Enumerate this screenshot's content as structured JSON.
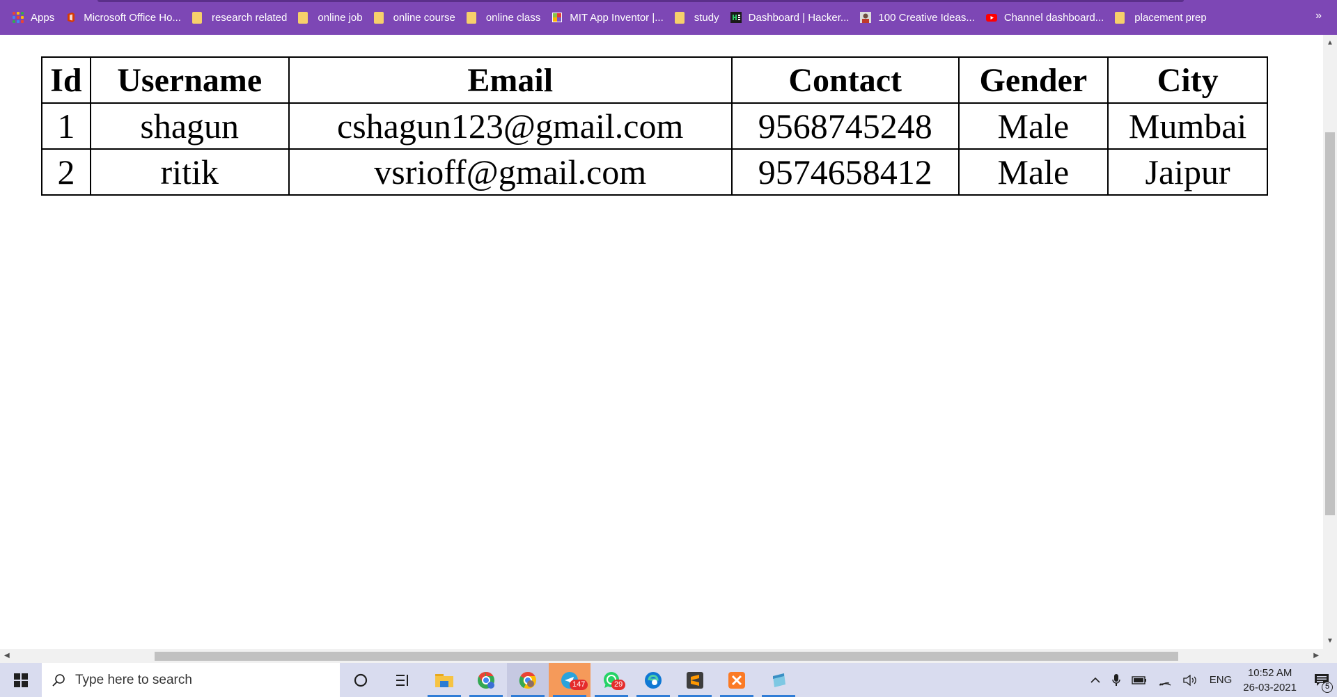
{
  "bookmarks": {
    "items": [
      {
        "label": "Apps",
        "icon": "apps-grid-icon"
      },
      {
        "label": "Microsoft Office Ho...",
        "icon": "office-icon"
      },
      {
        "label": "research related",
        "icon": "folder-icon"
      },
      {
        "label": "online job",
        "icon": "folder-icon"
      },
      {
        "label": "online course",
        "icon": "folder-icon"
      },
      {
        "label": "online class",
        "icon": "folder-icon"
      },
      {
        "label": "MIT App Inventor |...",
        "icon": "app-inventor-icon"
      },
      {
        "label": "study",
        "icon": "folder-icon"
      },
      {
        "label": "Dashboard | Hacker...",
        "icon": "hackerearth-icon"
      },
      {
        "label": "100 Creative Ideas...",
        "icon": "avatar-icon"
      },
      {
        "label": "Channel dashboard...",
        "icon": "youtube-icon"
      },
      {
        "label": "placement prep",
        "icon": "folder-icon"
      }
    ],
    "more": "»"
  },
  "table": {
    "headers": [
      "Id",
      "Username",
      "Email",
      "Contact",
      "Gender",
      "City"
    ],
    "rows": [
      [
        "1",
        "shagun",
        "cshagun123@gmail.com",
        "9568745248",
        "Male",
        "Mumbai"
      ],
      [
        "2",
        "ritik",
        "vsrioff@gmail.com",
        "9574658412",
        "Male",
        "Jaipur"
      ]
    ]
  },
  "taskbar": {
    "search_placeholder": "Type here to search",
    "apps": [
      {
        "name": "cortana-icon"
      },
      {
        "name": "task-view-icon"
      },
      {
        "name": "file-explorer-icon"
      },
      {
        "name": "chrome-profile-icon"
      },
      {
        "name": "chrome-icon"
      },
      {
        "name": "telegram-icon",
        "badge": "147"
      },
      {
        "name": "whatsapp-icon",
        "badge": "29"
      },
      {
        "name": "edge-icon"
      },
      {
        "name": "sublime-text-icon"
      },
      {
        "name": "xampp-icon"
      },
      {
        "name": "notepad-icon"
      }
    ],
    "tray": {
      "language": "ENG",
      "time": "10:52 AM",
      "date": "26-03-2021",
      "notifications": "5"
    }
  },
  "colors": {
    "bookmark_bar": "#7d47b5",
    "taskbar": "#d9dcef",
    "folder": "#f6d06b"
  }
}
